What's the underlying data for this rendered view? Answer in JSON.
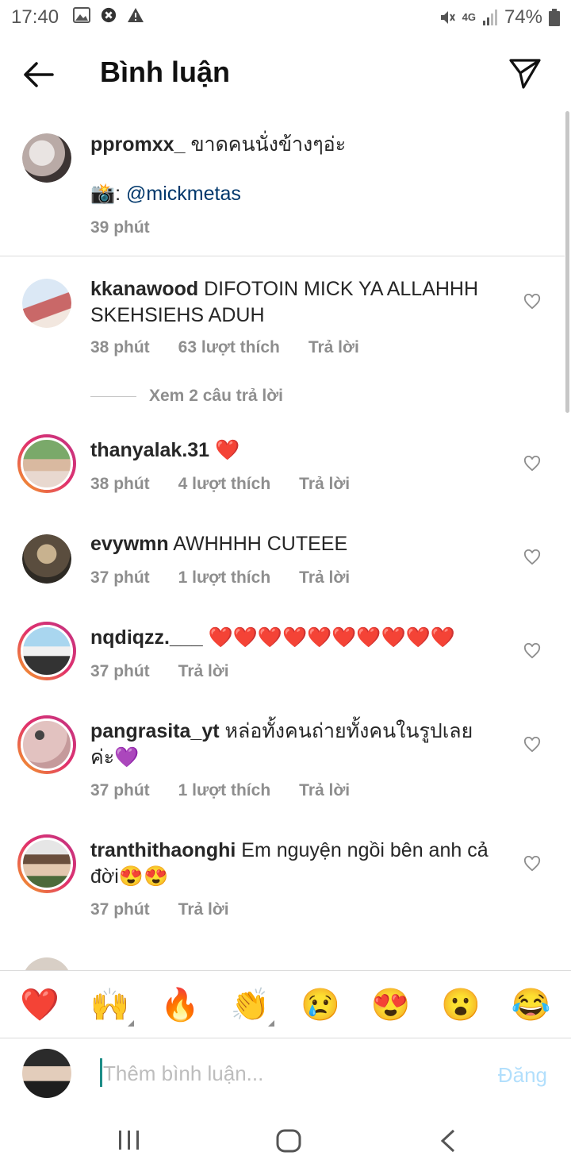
{
  "status_bar": {
    "time": "17:40",
    "battery": "74%",
    "network": "4G"
  },
  "header": {
    "title": "Bình luận"
  },
  "caption": {
    "username": "ppromxx_",
    "text": "ขาดคนนั่งข้างๆอ่ะ",
    "camera_emoji": "📸",
    "credit_prefix": ": ",
    "credit_mention": "@mickmetas",
    "time": "39 phút"
  },
  "comments": [
    {
      "username": "kkanawood",
      "text": "DIFOTOIN MICK YA ALLAHHH SKEHSIEHS ADUH",
      "time": "38 phút",
      "likes": "63 lượt thích",
      "reply": "Trả lời",
      "view_replies": "Xem 2 câu trả lời"
    },
    {
      "username": "thanyalak.31",
      "text": "❤️",
      "time": "38 phút",
      "likes": "4 lượt thích",
      "reply": "Trả lời"
    },
    {
      "username": "evywmn",
      "text": "AWHHHH CUTEEE",
      "time": "37 phút",
      "likes": "1 lượt thích",
      "reply": "Trả lời"
    },
    {
      "username": "nqdiqzz.___",
      "text": "❤️❤️❤️❤️❤️❤️❤️❤️❤️❤️",
      "time": "37 phút",
      "reply": "Trả lời"
    },
    {
      "username": "pangrasita_yt",
      "text": "หล่อทั้งคนถ่ายทั้งคนในรูปเลยค่ะ💜",
      "time": "37 phút",
      "likes": "1 lượt thích",
      "reply": "Trả lời"
    },
    {
      "username": "tranthithaonghi",
      "text": "Em nguyện ngồi bên anh cả đời😍😍",
      "time": "37 phút",
      "reply": "Trả lời"
    }
  ],
  "reactions": [
    "❤️",
    "🙌",
    "🔥",
    "👏",
    "😢",
    "😍",
    "😮",
    "😂"
  ],
  "input": {
    "placeholder": "Thêm bình luận...",
    "post_label": "Đăng"
  },
  "colors": {
    "link": "#00376b",
    "muted": "#8e8e8e",
    "post_disabled": "#b2dffc",
    "heart": "#ed4956"
  },
  "icons": {
    "back": "arrow-left-icon",
    "send": "paper-plane-icon",
    "like": "heart-outline-icon"
  }
}
